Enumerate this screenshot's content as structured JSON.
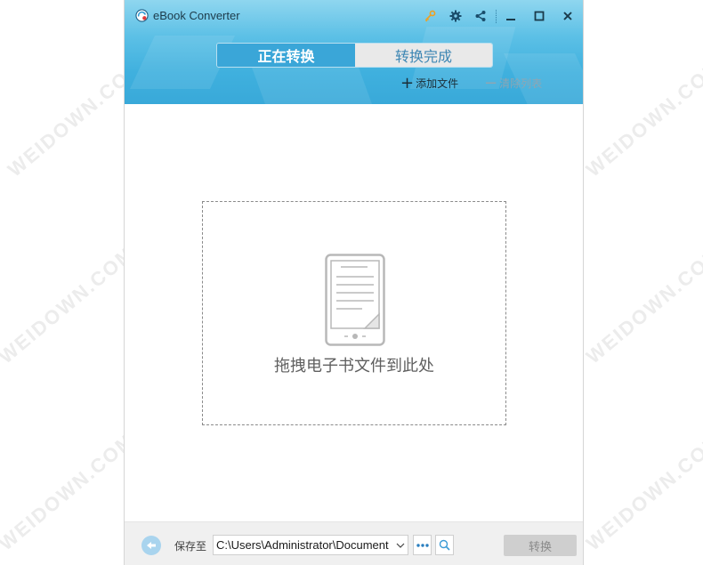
{
  "app": {
    "title": "eBook Converter",
    "icon": "ebook-converter-logo-icon"
  },
  "titlebar_icons": [
    "key-icon",
    "gear-icon",
    "share-icon",
    "minimize-icon",
    "maximize-icon",
    "close-icon"
  ],
  "tabs": [
    {
      "label": "正在转换",
      "active": true
    },
    {
      "label": "转换完成",
      "active": false
    }
  ],
  "actions": {
    "add_label": "添加文件",
    "clear_label": "清除列表"
  },
  "dropzone": {
    "text": "拖拽电子书文件到此处",
    "icon": "ebook-reader-icon"
  },
  "footer": {
    "save_label": "保存至",
    "path_value": "C:\\Users\\Administrator\\Document",
    "convert_label": "转换"
  },
  "colors": {
    "header_blue": "#3fb0de",
    "active_tab": "#3aa6d8",
    "key_icon": "#f0a020"
  },
  "watermark": "WEIDOWN.COM"
}
